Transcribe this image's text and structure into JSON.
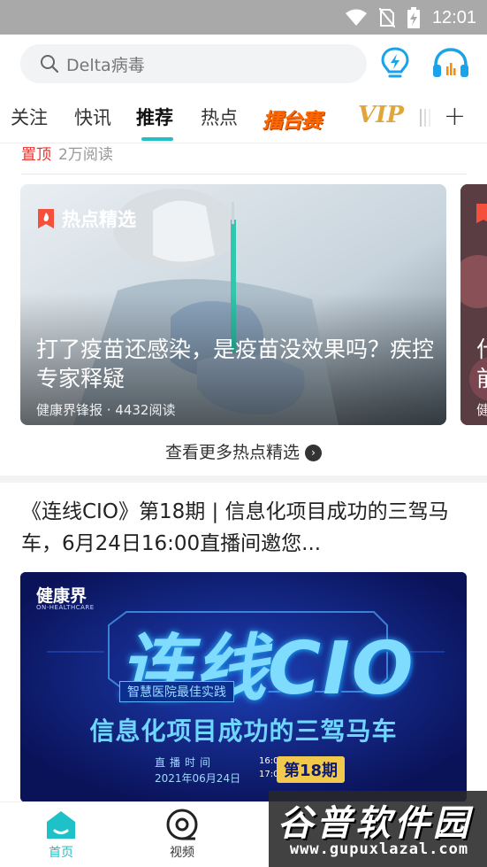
{
  "status_bar": {
    "time": "12:01"
  },
  "search": {
    "placeholder": "Delta病毒"
  },
  "tabs": {
    "items": [
      "关注",
      "快讯",
      "推荐",
      "热点"
    ],
    "active": "推荐",
    "leitai": "擂台赛",
    "vip": "VIP"
  },
  "top_meta": {
    "pin": "置顶",
    "reads": "2万阅读"
  },
  "hot_card": {
    "tag": "热点精选",
    "title": "打了疫苗还感染，是疫苗没效果吗？疾控专家释疑",
    "source": "健康界锋报 · 4432阅读"
  },
  "peek_card": {
    "title_fragment": "什\n前",
    "source_fragment": "健"
  },
  "more_link": "查看更多热点精选",
  "article": {
    "title": "《连线CIO》第18期 | 信息化项目成功的三驾马车，6月24日16:00直播间邀您..."
  },
  "banner": {
    "logo": "健康界",
    "logo_sub": "ON-HEALTHCARE",
    "big": "连线CIO",
    "ribbon": "智慧医院最佳实践",
    "subtitle": "信息化项目成功的三驾马车",
    "live_label": "直播时间",
    "date": "2021年06月24日",
    "time_start": "16:00",
    "time_end": "17:00",
    "issue": "第18期"
  },
  "bottom_nav": [
    {
      "label": "首页",
      "icon": "home-icon",
      "active": true
    },
    {
      "label": "视频",
      "icon": "video-disc-icon",
      "active": false
    }
  ],
  "watermark": {
    "title": "谷普软件园",
    "url": "www.gupuxlazal.com"
  },
  "colors": {
    "accent": "#1ec1c7",
    "pin_red": "#e8332c",
    "banner_bg": "#0d1a6e"
  }
}
